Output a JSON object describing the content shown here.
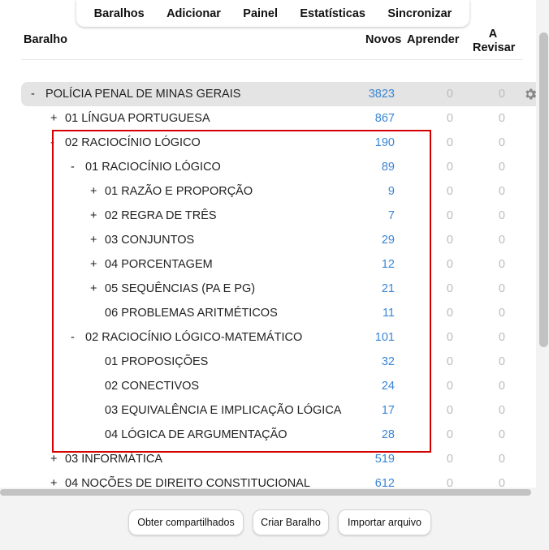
{
  "nav": {
    "items": [
      "Baralhos",
      "Adicionar",
      "Painel",
      "Estatísticas",
      "Sincronizar"
    ]
  },
  "table": {
    "headers": {
      "deck": "Baralho",
      "new": "Novos",
      "learn": "Aprender",
      "review_line1": "A",
      "review_line2": "Revisar"
    },
    "rows": [
      {
        "control": "-",
        "name": "POLÍCIA PENAL DE MINAS GERAIS",
        "new": "3823",
        "learn": "0",
        "review": "0"
      },
      {
        "control": "+",
        "name": "01 LÍNGUA PORTUGUESA",
        "new": "867",
        "learn": "0",
        "review": "0"
      },
      {
        "control": "-",
        "name": "02 RACIOCÍNIO LÓGICO",
        "new": "190",
        "learn": "0",
        "review": "0"
      },
      {
        "control": "-",
        "name": "01 RACIOCÍNIO LÓGICO",
        "new": "89",
        "learn": "0",
        "review": "0"
      },
      {
        "control": "+",
        "name": "01 RAZÃO E PROPORÇÃO",
        "new": "9",
        "learn": "0",
        "review": "0"
      },
      {
        "control": "+",
        "name": "02 REGRA DE TRÊS",
        "new": "7",
        "learn": "0",
        "review": "0"
      },
      {
        "control": "+",
        "name": "03 CONJUNTOS",
        "new": "29",
        "learn": "0",
        "review": "0"
      },
      {
        "control": "+",
        "name": "04 PORCENTAGEM",
        "new": "12",
        "learn": "0",
        "review": "0"
      },
      {
        "control": "+",
        "name": "05 SEQUÊNCIAS (PA E PG)",
        "new": "21",
        "learn": "0",
        "review": "0"
      },
      {
        "control": "",
        "name": "06 PROBLEMAS ARITMÉTICOS",
        "new": "11",
        "learn": "0",
        "review": "0"
      },
      {
        "control": "-",
        "name": "02 RACIOCÍNIO LÓGICO-MATEMÁTICO",
        "new": "101",
        "learn": "0",
        "review": "0"
      },
      {
        "control": "",
        "name": "01 PROPOSIÇÕES",
        "new": "32",
        "learn": "0",
        "review": "0"
      },
      {
        "control": "",
        "name": "02 CONECTIVOS",
        "new": "24",
        "learn": "0",
        "review": "0"
      },
      {
        "control": "",
        "name": "03 EQUIVALÊNCIA E IMPLICAÇÃO LÓGICA",
        "new": "17",
        "learn": "0",
        "review": "0"
      },
      {
        "control": "",
        "name": "04 LÓGICA DE ARGUMENTAÇÃO",
        "new": "28",
        "learn": "0",
        "review": "0"
      },
      {
        "control": "+",
        "name": "03 INFORMÁTICA",
        "new": "519",
        "learn": "0",
        "review": "0"
      },
      {
        "control": "+",
        "name": "04 NOÇÕES DE DIREITO CONSTITUCIONAL",
        "new": "612",
        "learn": "0",
        "review": "0"
      }
    ]
  },
  "buttons": {
    "get_shared": "Obter compartilhados",
    "create_deck": "Criar Baralho",
    "import_file": "Importar arquivo"
  },
  "colors": {
    "new_count": "#3a86d4",
    "zero_count": "#bbbbbb",
    "highlight_border": "#d40000"
  },
  "icons": {
    "deck_options": "gear-icon"
  }
}
